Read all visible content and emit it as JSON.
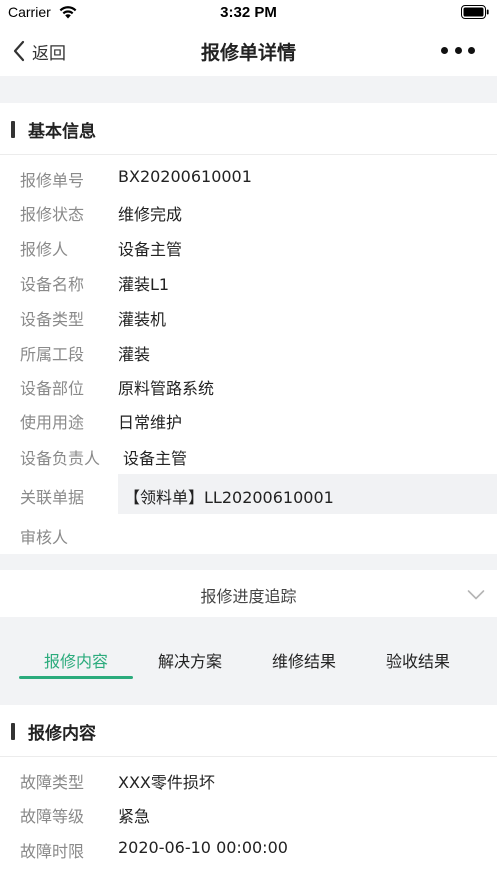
{
  "status_bar": {
    "carrier": "Carrier",
    "time": "3:32 PM"
  },
  "nav": {
    "back_label": "返回",
    "title": "报修单详情"
  },
  "basic_info": {
    "title": "基本信息",
    "rows": [
      {
        "label": "报修单号",
        "value": "BX20200610001"
      },
      {
        "label": "报修状态",
        "value": "维修完成"
      },
      {
        "label": "报修人",
        "value": "设备主管"
      },
      {
        "label": "设备名称",
        "value": "灌装L1"
      },
      {
        "label": "设备类型",
        "value": "灌装机"
      },
      {
        "label": "所属工段",
        "value": "灌装"
      },
      {
        "label": "设备部位",
        "value": "原料管路系统"
      },
      {
        "label": "使用用途",
        "value": "日常维护"
      },
      {
        "label": "设备负责人",
        "value": "设备主管"
      },
      {
        "label": "关联单据",
        "value": "【领料单】LL20200610001"
      },
      {
        "label": "审核人",
        "value": ""
      }
    ]
  },
  "tracking": {
    "title": "报修进度追踪"
  },
  "tabs": {
    "items": [
      "报修内容",
      "解决方案",
      "维修结果",
      "验收结果"
    ],
    "active": "报修内容"
  },
  "repair_content": {
    "title": "报修内容",
    "rows": [
      {
        "label": "故障类型",
        "value": "XXX零件损坏"
      },
      {
        "label": "故障等级",
        "value": "紧急"
      },
      {
        "label": "故障时限",
        "value": "2020-06-10 00:00:00"
      }
    ]
  },
  "colors": {
    "accent": "#2bab7c",
    "background_gray": "#f2f3f5",
    "label_gray": "#8a8a8a"
  }
}
